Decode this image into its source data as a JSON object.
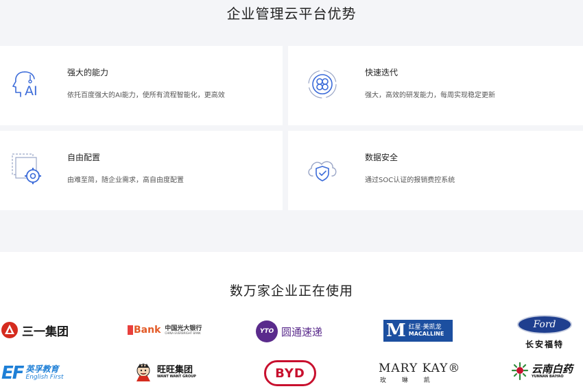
{
  "advantages": {
    "title": "企业管理云平台优势",
    "cards": [
      {
        "title": "强大的能力",
        "desc": "依托百度强大的AI能力，使所有流程智能化，更高效",
        "icon": "ai-head-icon"
      },
      {
        "title": "快速迭代",
        "desc": "强大，高效的研发能力，每周实现稳定更新",
        "icon": "iterate-icon"
      },
      {
        "title": "自由配置",
        "desc": "由难至简，随企业需求，高自由度配置",
        "icon": "config-gear-icon"
      },
      {
        "title": "数据安全",
        "desc": "通过SOC认证的报销费控系统",
        "icon": "cloud-shield-icon"
      }
    ]
  },
  "users": {
    "title": "数万家企业正在使用",
    "logos": [
      {
        "name": "三一集团"
      },
      {
        "name": "Bank",
        "sub": "中国光大银行",
        "sub2": "CHINA EVERBRIGHT BANK"
      },
      {
        "name": "圆通速递",
        "badge": "YTO"
      },
      {
        "name": "MACALLINE",
        "sub": "红星·美凯龙",
        "badge": "M"
      },
      {
        "name": "Ford",
        "sub": "长安福特"
      },
      {
        "name": "英孚教育",
        "sub": "English First",
        "badge": "EF"
      },
      {
        "name": "旺旺集团",
        "sub": "WANT WANT GROUP"
      },
      {
        "name": "BYD"
      },
      {
        "name": "MARY KAY®",
        "sub": "玫  琳  凯"
      },
      {
        "name": "云南白药",
        "sub": "YUNNAN BAIYAO"
      }
    ]
  },
  "colors": {
    "blue": "#3b6bd9",
    "red": "#d52b1e",
    "yto_purple": "#5a2b8c",
    "macalline_blue": "#1c4fa0",
    "ford_blue": "#1f3f8f",
    "ef_blue": "#1e7fd6",
    "byd_red": "#c8102e"
  }
}
